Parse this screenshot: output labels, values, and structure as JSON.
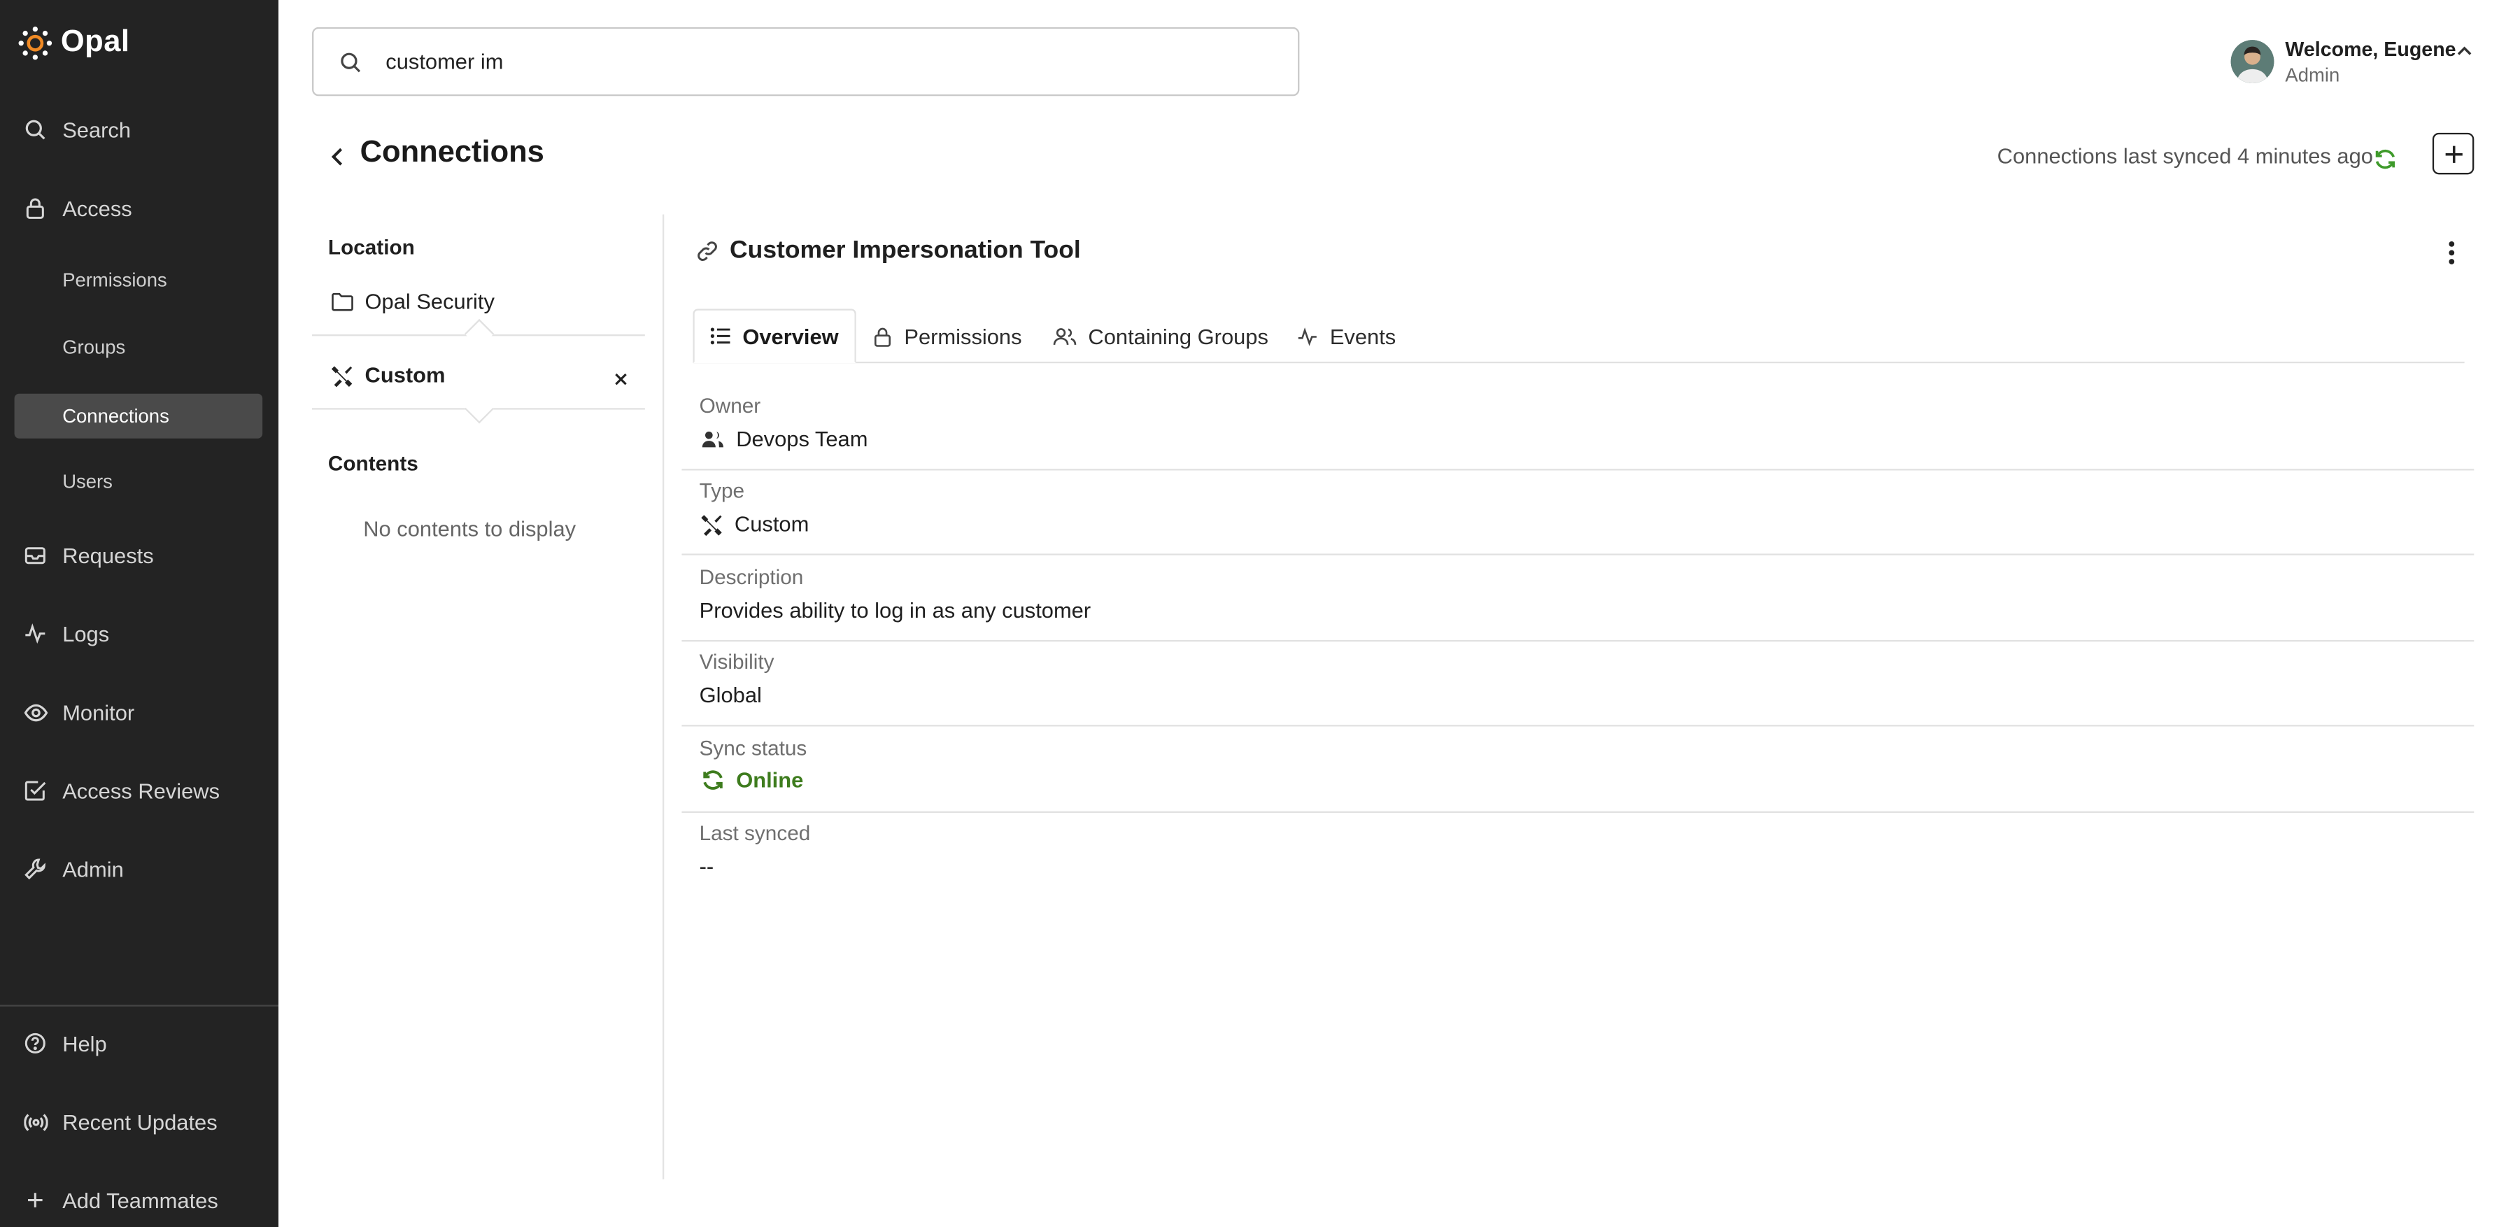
{
  "app": {
    "name": "Opal"
  },
  "sidebar": {
    "items": [
      {
        "label": "Search",
        "icon": "search-icon"
      },
      {
        "label": "Access",
        "icon": "lock-icon"
      },
      {
        "label": "Requests",
        "icon": "inbox-icon"
      },
      {
        "label": "Logs",
        "icon": "activity-icon"
      },
      {
        "label": "Monitor",
        "icon": "eye-icon"
      },
      {
        "label": "Access Reviews",
        "icon": "checkbox-icon"
      },
      {
        "label": "Admin",
        "icon": "wrench-icon"
      }
    ],
    "access_sub": [
      {
        "label": "Permissions"
      },
      {
        "label": "Groups"
      },
      {
        "label": "Connections",
        "active": true
      },
      {
        "label": "Users"
      }
    ],
    "bottom": [
      {
        "label": "Help",
        "icon": "help-circle-icon"
      },
      {
        "label": "Recent Updates",
        "icon": "broadcast-icon"
      },
      {
        "label": "Add Teammates",
        "icon": "plus-icon"
      }
    ]
  },
  "search": {
    "value": "customer im"
  },
  "user": {
    "welcome": "Welcome, Eugene",
    "role": "Admin"
  },
  "header": {
    "title": "Connections",
    "sync_status": "Connections last synced 4 minutes ago"
  },
  "left_panel": {
    "location_heading": "Location",
    "location_item": "Opal Security",
    "selected_item": "Custom",
    "contents_heading": "Contents",
    "empty_text": "No contents to display"
  },
  "resource": {
    "title": "Customer Impersonation Tool",
    "tabs": [
      {
        "label": "Overview",
        "icon": "list-icon",
        "active": true
      },
      {
        "label": "Permissions",
        "icon": "lock-icon"
      },
      {
        "label": "Containing Groups",
        "icon": "users-icon"
      },
      {
        "label": "Events",
        "icon": "activity-icon"
      }
    ],
    "fields": {
      "owner": {
        "label": "Owner",
        "value": "Devops Team"
      },
      "type": {
        "label": "Type",
        "value": "Custom"
      },
      "description": {
        "label": "Description",
        "value": "Provides ability to log in as any customer"
      },
      "visibility": {
        "label": "Visibility",
        "value": "Global"
      },
      "sync_status": {
        "label": "Sync status",
        "value": "Online"
      },
      "last_synced": {
        "label": "Last synced",
        "value": "--"
      }
    }
  },
  "colors": {
    "sidebar_bg": "#232323",
    "accent_green": "#3e7c1e",
    "active_item_bg": "#4a4a4a"
  }
}
